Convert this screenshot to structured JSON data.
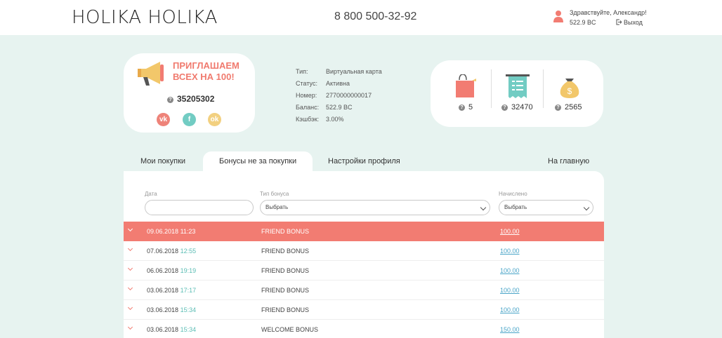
{
  "header": {
    "logo": "HOLIKA HOLIKA",
    "phone": "8 800 500-32-92",
    "greeting": "Здравствуйте, Александр!",
    "balance": "522.9 BC",
    "logout": "Выход"
  },
  "promo": {
    "line1": "ПРИГЛАШАЕМ",
    "line2": "ВСЕХ НА 100!",
    "code": "35205302",
    "icon": "megaphone-icon",
    "social": [
      {
        "icon": "vk-icon",
        "glyph": "vk"
      },
      {
        "icon": "facebook-icon",
        "glyph": "f"
      },
      {
        "icon": "odnoklassniki-icon",
        "glyph": "ok"
      }
    ]
  },
  "card_info": {
    "rows": [
      {
        "label": "Тип:",
        "value": "Виртуальная карта"
      },
      {
        "label": "Статус:",
        "value": "Активна"
      },
      {
        "label": "Номер:",
        "value": "2770000000017"
      },
      {
        "label": "Баланс:",
        "value": "522.9 BC"
      },
      {
        "label": "Кэшбэк:",
        "value": "3.00%"
      }
    ]
  },
  "stats": [
    {
      "icon": "shopping-bag-icon",
      "value": "5"
    },
    {
      "icon": "receipt-icon",
      "value": "32470"
    },
    {
      "icon": "money-bag-icon",
      "value": "2565"
    }
  ],
  "tabs": {
    "purchases": "Мои покупки",
    "bonuses": "Бонусы не за покупки",
    "settings": "Настройки профиля",
    "home": "На главную"
  },
  "filters": {
    "date_label": "Дата",
    "date_value": "",
    "type_label": "Тип бонуса",
    "type_value": "Выбрать",
    "accrued_label": "Начислено",
    "accrued_value": "Выбрать"
  },
  "rows": [
    {
      "date": "09.06.2018",
      "time": "11:23",
      "type": "FRIEND BONUS",
      "amount": "100.00",
      "active": true
    },
    {
      "date": "07.06.2018",
      "time": "12:55",
      "type": "FRIEND BONUS",
      "amount": "100.00",
      "active": false
    },
    {
      "date": "06.06.2018",
      "time": "19:19",
      "type": "FRIEND BONUS",
      "amount": "100.00",
      "active": false
    },
    {
      "date": "03.06.2018",
      "time": "17:17",
      "type": "FRIEND BONUS",
      "amount": "100.00",
      "active": false
    },
    {
      "date": "03.06.2018",
      "time": "15:34",
      "type": "FRIEND BONUS",
      "amount": "100.00",
      "active": false
    },
    {
      "date": "03.06.2018",
      "time": "15:34",
      "type": "WELCOME BONUS",
      "amount": "150.00",
      "active": false
    }
  ],
  "colors": {
    "accent": "#f27c72",
    "teal": "#5bbdb4",
    "background": "#e7f3f0"
  }
}
